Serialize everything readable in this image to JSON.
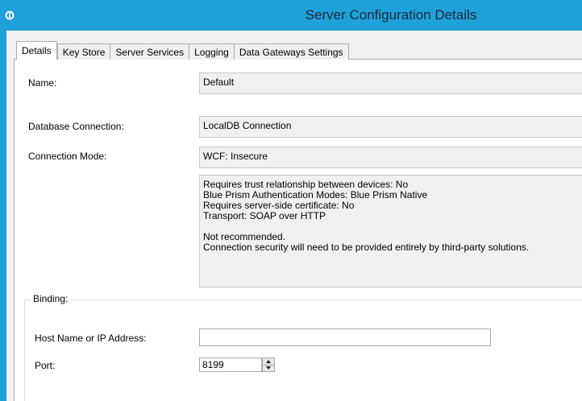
{
  "window": {
    "title": "Server Configuration Details",
    "app_icon": "blue-prism-app-icon",
    "accent_color": "#1fa0d8"
  },
  "tabs": [
    {
      "label": "Details",
      "active": true
    },
    {
      "label": "Key Store",
      "active": false
    },
    {
      "label": "Server Services",
      "active": false
    },
    {
      "label": "Logging",
      "active": false
    },
    {
      "label": "Data Gateways Settings",
      "active": false
    }
  ],
  "details": {
    "name_label": "Name:",
    "name_value": "Default",
    "db_label": "Database Connection:",
    "db_value": "LocalDB Connection",
    "mode_label": "Connection Mode:",
    "mode_value": "WCF: Insecure",
    "description": {
      "line1": "Requires trust relationship between devices: No",
      "line2": "Blue Prism Authentication Modes: Blue Prism Native",
      "line3": "Requires server-side certificate: No",
      "line4": "Transport: SOAP over HTTP",
      "line5": "Not recommended.",
      "line6": "Connection security will need to be provided entirely by third-party solutions."
    }
  },
  "binding": {
    "legend": "Binding:",
    "host_label": "Host Name or IP Address:",
    "host_value": "",
    "port_label": "Port:",
    "port_value": "8199"
  }
}
